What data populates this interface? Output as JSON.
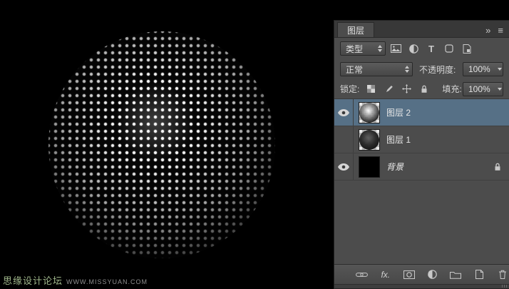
{
  "canvas": {
    "watermark": {
      "site_name": "思缘设计论坛",
      "site_url": "WWW.MISSYUAN.COM"
    }
  },
  "panel": {
    "tab_title": "图层",
    "glyphs": {
      "collapse": "»",
      "menu": "≡"
    },
    "filter_row": {
      "type_label": "类型",
      "type_filter_letter": "T"
    },
    "blend_row": {
      "blend_mode": "正常",
      "opacity_label": "不透明度:",
      "opacity_value": "100%"
    },
    "lock_row": {
      "lock_label": "锁定:",
      "fill_label": "填充:",
      "fill_value": "100%"
    },
    "layers": [
      {
        "name": "图层 2",
        "visible": true,
        "selected": true,
        "locked": false
      },
      {
        "name": "图层 1",
        "visible": false,
        "selected": false,
        "locked": false
      },
      {
        "name": "背景",
        "visible": true,
        "selected": false,
        "locked": true
      }
    ],
    "footer": {
      "fx_label": "fx."
    }
  },
  "colors": {
    "selected_row": "#567086",
    "panel_background": "#4c4c4c",
    "canvas_background": "#000000",
    "watermark_green": "#9fb68a"
  }
}
